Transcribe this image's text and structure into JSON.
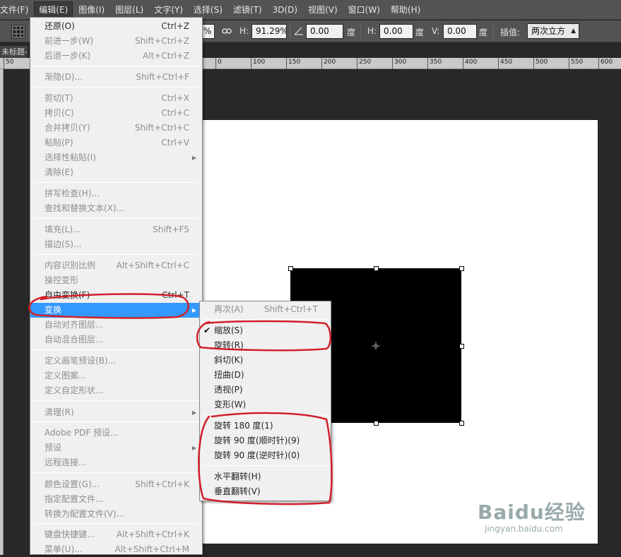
{
  "menubar": {
    "items": [
      {
        "label": "文件(F)"
      },
      {
        "label": "编辑(E)"
      },
      {
        "label": "图像(I)"
      },
      {
        "label": "图层(L)"
      },
      {
        "label": "文字(Y)"
      },
      {
        "label": "选择(S)"
      },
      {
        "label": "滤镜(T)"
      },
      {
        "label": "3D(D)"
      },
      {
        "label": "视图(V)"
      },
      {
        "label": "窗口(W)"
      },
      {
        "label": "帮助(H)"
      }
    ]
  },
  "options_bar": {
    "width_value": "%",
    "height_label": "H:",
    "height_value": "91.29%",
    "angle_value": "0.00",
    "angle_unit": "度",
    "hskew_label": "H:",
    "hskew_value": "0.00",
    "hskew_unit": "度",
    "vskew_label": "V:",
    "vskew_value": "0.00",
    "vskew_unit": "度",
    "interp_label": "插值:",
    "interp_value": "两次立方"
  },
  "document": {
    "tab_title": "未标题-"
  },
  "ruler": {
    "labels": [
      "50",
      "0",
      "50",
      "100",
      "150",
      "200",
      "250",
      "300",
      "350",
      "400",
      "450",
      "500",
      "550",
      "600"
    ]
  },
  "edit_menu": {
    "items": [
      {
        "label": "还原(O)",
        "shortcut": "Ctrl+Z",
        "enabled": true
      },
      {
        "label": "前进一步(W)",
        "shortcut": "Shift+Ctrl+Z",
        "enabled": false
      },
      {
        "label": "后退一步(K)",
        "shortcut": "Alt+Ctrl+Z",
        "enabled": false
      },
      {
        "label": "渐隐(D)...",
        "shortcut": "Shift+Ctrl+F",
        "enabled": false
      },
      {
        "label": "剪切(T)",
        "shortcut": "Ctrl+X",
        "enabled": false
      },
      {
        "label": "拷贝(C)",
        "shortcut": "Ctrl+C",
        "enabled": false
      },
      {
        "label": "合并拷贝(Y)",
        "shortcut": "Shift+Ctrl+C",
        "enabled": false
      },
      {
        "label": "粘贴(P)",
        "shortcut": "Ctrl+V",
        "enabled": false
      },
      {
        "label": "选择性粘贴(I)",
        "shortcut": "",
        "enabled": false
      },
      {
        "label": "清除(E)",
        "shortcut": "",
        "enabled": false
      },
      {
        "label": "拼写检查(H)...",
        "shortcut": "",
        "enabled": false
      },
      {
        "label": "查找和替换文本(X)...",
        "shortcut": "",
        "enabled": false
      },
      {
        "label": "填充(L)...",
        "shortcut": "Shift+F5",
        "enabled": false
      },
      {
        "label": "描边(S)...",
        "shortcut": "",
        "enabled": false
      },
      {
        "label": "内容识别比例",
        "shortcut": "Alt+Shift+Ctrl+C",
        "enabled": false
      },
      {
        "label": "操控变形",
        "shortcut": "",
        "enabled": false
      },
      {
        "label": "自由变换(F)",
        "shortcut": "Ctrl+T",
        "enabled": true
      },
      {
        "label": "变换",
        "shortcut": "",
        "enabled": true
      },
      {
        "label": "自动对齐图层...",
        "shortcut": "",
        "enabled": false
      },
      {
        "label": "自动混合图层...",
        "shortcut": "",
        "enabled": false
      },
      {
        "label": "定义画笔预设(B)...",
        "shortcut": "",
        "enabled": false
      },
      {
        "label": "定义图案...",
        "shortcut": "",
        "enabled": false
      },
      {
        "label": "定义自定形状...",
        "shortcut": "",
        "enabled": false
      },
      {
        "label": "清理(R)",
        "shortcut": "",
        "enabled": false
      },
      {
        "label": "Adobe PDF 预设...",
        "shortcut": "",
        "enabled": false
      },
      {
        "label": "预设",
        "shortcut": "",
        "enabled": false
      },
      {
        "label": "远程连接...",
        "shortcut": "",
        "enabled": false
      },
      {
        "label": "颜色设置(G)...",
        "shortcut": "Shift+Ctrl+K",
        "enabled": false
      },
      {
        "label": "指定配置文件...",
        "shortcut": "",
        "enabled": false
      },
      {
        "label": "转换为配置文件(V)...",
        "shortcut": "",
        "enabled": false
      },
      {
        "label": "键盘快捷键...",
        "shortcut": "Alt+Shift+Ctrl+K",
        "enabled": false
      },
      {
        "label": "菜单(U)...",
        "shortcut": "Alt+Shift+Ctrl+M",
        "enabled": false
      }
    ]
  },
  "transform_menu": {
    "items": [
      {
        "label": "再次(A)",
        "shortcut": "Shift+Ctrl+T",
        "enabled": false
      },
      {
        "label": "缩放(S)",
        "shortcut": "",
        "enabled": true,
        "checked": true
      },
      {
        "label": "旋转(R)",
        "shortcut": "",
        "enabled": true
      },
      {
        "label": "斜切(K)",
        "shortcut": "",
        "enabled": true
      },
      {
        "label": "扭曲(D)",
        "shortcut": "",
        "enabled": true
      },
      {
        "label": "透视(P)",
        "shortcut": "",
        "enabled": true
      },
      {
        "label": "变形(W)",
        "shortcut": "",
        "enabled": true
      },
      {
        "label": "旋转 180 度(1)",
        "shortcut": "",
        "enabled": true
      },
      {
        "label": "旋转 90 度(顺时针)(9)",
        "shortcut": "",
        "enabled": true
      },
      {
        "label": "旋转 90 度(逆时针)(0)",
        "shortcut": "",
        "enabled": true
      },
      {
        "label": "水平翻转(H)",
        "shortcut": "",
        "enabled": true
      },
      {
        "label": "垂直翻转(V)",
        "shortcut": "",
        "enabled": true
      }
    ]
  },
  "watermark": {
    "brand": "Baidu经验",
    "url": "jingyan.baidu.com"
  },
  "colors": {
    "highlight": "#3399ff",
    "annotation": "#d0202a"
  }
}
